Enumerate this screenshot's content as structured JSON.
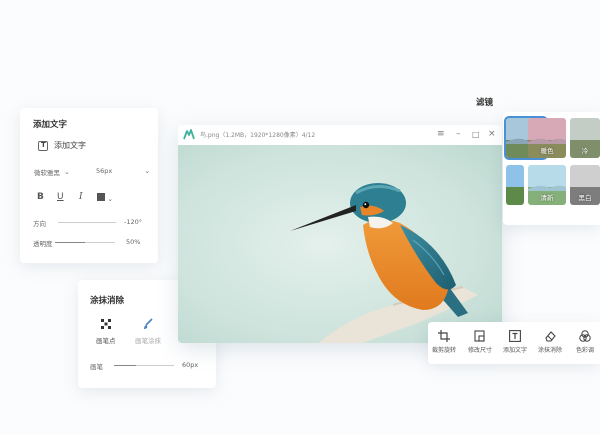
{
  "text_panel": {
    "title": "添加文字",
    "add_text_label": "添加文字",
    "font_family": "微软雅黑",
    "font_size": "56px",
    "format": {
      "bold": "B",
      "underline": "U",
      "italic": "I"
    },
    "direction_label": "方向",
    "direction_value": "-120°",
    "opacity_label": "透明度",
    "opacity_value": "50%"
  },
  "erase_panel": {
    "title": "涂抹消除",
    "tool_pen": "画笔点",
    "tool_brush": "画笔涂抹",
    "size_label": "画笔",
    "size_value": "60px"
  },
  "main_window": {
    "file_info": "鸟.png（1.2MB，1920*1280像素）4/12",
    "accent_color": "#3bb29b"
  },
  "bottom_toolbar": {
    "items": [
      {
        "label": "裁剪旋转",
        "icon": "crop-icon"
      },
      {
        "label": "修改尺寸",
        "icon": "resize-icon"
      },
      {
        "label": "添加文字",
        "icon": "text-icon"
      },
      {
        "label": "涂抹消除",
        "icon": "eraser-icon"
      },
      {
        "label": "色彩调",
        "icon": "color-icon"
      }
    ]
  },
  "filter_panel": {
    "title": "滤镜",
    "filters": [
      {
        "label": "",
        "selected": true
      },
      {
        "label": "暖色",
        "selected": false
      },
      {
        "label": "冷",
        "selected": false
      },
      {
        "label": "",
        "selected": false
      },
      {
        "label": "清新",
        "selected": false
      },
      {
        "label": "黑白",
        "selected": false
      }
    ]
  }
}
